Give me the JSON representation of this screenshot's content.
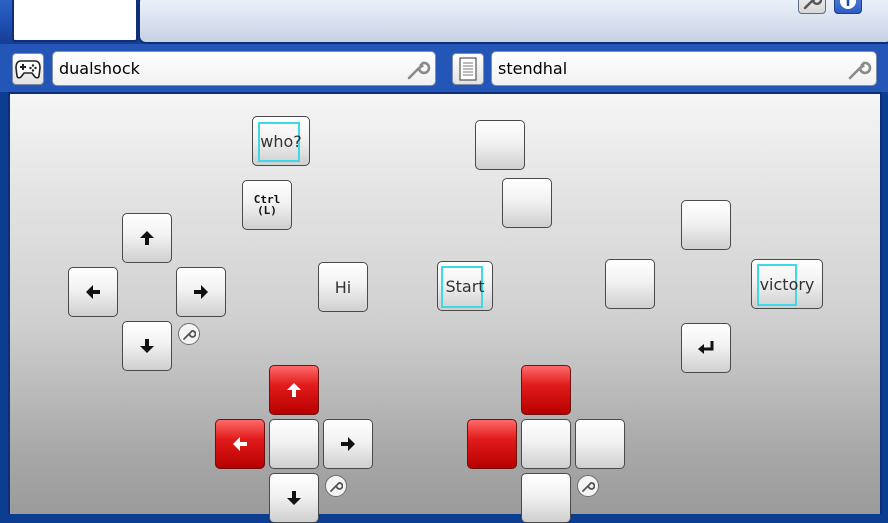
{
  "controller_field": {
    "value": "dualshock",
    "icon": "gamepad-icon"
  },
  "keymap_field": {
    "value": "stendhal",
    "icon": "notepad-icon"
  },
  "toolbar": {
    "settings_icon": "wrench-icon",
    "help_icon": "help-icon"
  },
  "left_cluster": {
    "top_button_label": "who?",
    "ctrl_label_top": "Ctrl",
    "ctrl_label_bottom": "(L)",
    "mid_button_label": "Hi"
  },
  "center_cluster": {
    "start_label": "Start"
  },
  "right_cluster": {
    "face_label": "victory"
  },
  "colors": {
    "accent_red": "#e11b1b",
    "selection": "#3fd8e8",
    "frame_blue": "#2356b6"
  }
}
